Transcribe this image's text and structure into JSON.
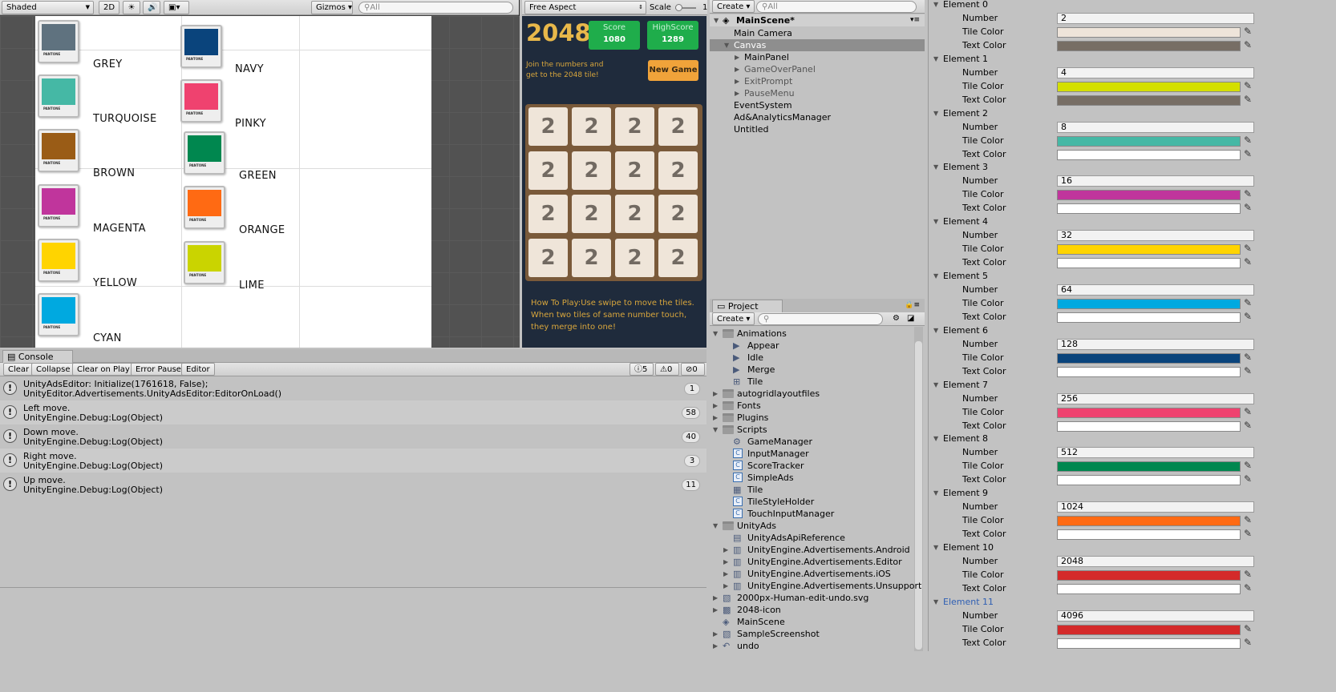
{
  "scene": {
    "shading": "Shaded",
    "mode_2d": "2D",
    "gizmos": "Gizmos",
    "search": "All",
    "colors": [
      {
        "name": "GREY",
        "hex": "#5f727f",
        "pl": "PANTONE"
      },
      {
        "name": "TURQUOISE",
        "hex": "#45b8a5",
        "pl": "PANTONE"
      },
      {
        "name": "BROWN",
        "hex": "#9a5c16",
        "pl": "PANTONE"
      },
      {
        "name": "MAGENTA",
        "hex": "#c0359c",
        "pl": "PANTONE"
      },
      {
        "name": "YELLOW",
        "hex": "#ffd400",
        "pl": "PANTONE"
      },
      {
        "name": "CYAN",
        "hex": "#00a9e0",
        "pl": "PANTONE"
      },
      {
        "name": "NAVY",
        "hex": "#0a447c",
        "pl": "PANTONE"
      },
      {
        "name": "PINKY",
        "hex": "#ef426f",
        "pl": "PANTONE"
      },
      {
        "name": "GREEN",
        "hex": "#00874f",
        "pl": "PANTONE"
      },
      {
        "name": "ORANGE",
        "hex": "#ff6a13",
        "pl": "PANTONE"
      },
      {
        "name": "LIME",
        "hex": "#cad400",
        "pl": "PANTONE"
      }
    ]
  },
  "game": {
    "aspect": "Free Aspect",
    "scale": "Scale",
    "scale_val": "1",
    "title": "2048",
    "score_label": "Score",
    "score": "1080",
    "high_label": "HighScore",
    "high": "1289",
    "tagline": "Join the numbers and get to the 2048 tile!",
    "new_game": "New Game",
    "tile_value": "2",
    "howto": "How To Play:Use swipe to move the tiles. When two tiles of same number touch, they merge into one!"
  },
  "console": {
    "tab": "Console",
    "buttons": [
      "Clear",
      "Collapse",
      "Clear on Play",
      "Error Pause",
      "Editor"
    ],
    "counts": [
      "5",
      "0",
      "0"
    ],
    "rows": [
      {
        "l1": "UnityAdsEditor: Initialize(1761618, False);",
        "l2": "UnityEditor.Advertisements.UnityAdsEditor:EditorOnLoad()",
        "n": "1"
      },
      {
        "l1": "Left move.",
        "l2": "UnityEngine.Debug:Log(Object)",
        "n": "58"
      },
      {
        "l1": "Down move.",
        "l2": "UnityEngine.Debug:Log(Object)",
        "n": "40"
      },
      {
        "l1": "Right move.",
        "l2": "UnityEngine.Debug:Log(Object)",
        "n": "3"
      },
      {
        "l1": "Up move.",
        "l2": "UnityEngine.Debug:Log(Object)",
        "n": "11"
      }
    ]
  },
  "hierarchy": {
    "create": "Create",
    "search": "All",
    "scene": "MainScene*",
    "items": [
      {
        "label": "Main Camera",
        "indent": 1,
        "arrow": "",
        "sel": false,
        "dim": false
      },
      {
        "label": "Canvas",
        "indent": 1,
        "arrow": "▼",
        "sel": true,
        "dim": false
      },
      {
        "label": "MainPanel",
        "indent": 2,
        "arrow": "▶",
        "sel": false,
        "dim": false
      },
      {
        "label": "GameOverPanel",
        "indent": 2,
        "arrow": "▶",
        "sel": false,
        "dim": true
      },
      {
        "label": "ExitPrompt",
        "indent": 2,
        "arrow": "▶",
        "sel": false,
        "dim": true
      },
      {
        "label": "PauseMenu",
        "indent": 2,
        "arrow": "▶",
        "sel": false,
        "dim": true
      },
      {
        "label": "EventSystem",
        "indent": 1,
        "arrow": "",
        "sel": false,
        "dim": false
      },
      {
        "label": "Ad&AnalyticsManager",
        "indent": 1,
        "arrow": "",
        "sel": false,
        "dim": false
      },
      {
        "label": "Untitled",
        "indent": 1,
        "arrow": "",
        "sel": false,
        "dim": false
      }
    ]
  },
  "project": {
    "tab": "Project",
    "create": "Create",
    "items": [
      {
        "label": "Animations",
        "lvl": 0,
        "arrow": "▼",
        "icon": "folder"
      },
      {
        "label": "Appear",
        "lvl": 1,
        "arrow": "",
        "icon": "anim"
      },
      {
        "label": "Idle",
        "lvl": 1,
        "arrow": "",
        "icon": "anim"
      },
      {
        "label": "Merge",
        "lvl": 1,
        "arrow": "",
        "icon": "anim"
      },
      {
        "label": "Tile",
        "lvl": 1,
        "arrow": "",
        "icon": "controller"
      },
      {
        "label": "autogridlayoutfiles",
        "lvl": 0,
        "arrow": "▶",
        "icon": "folder"
      },
      {
        "label": "Fonts",
        "lvl": 0,
        "arrow": "▶",
        "icon": "folder"
      },
      {
        "label": "Plugins",
        "lvl": 0,
        "arrow": "▶",
        "icon": "folder"
      },
      {
        "label": "Scripts",
        "lvl": 0,
        "arrow": "▼",
        "icon": "folder"
      },
      {
        "label": "GameManager",
        "lvl": 1,
        "arrow": "",
        "icon": "gear"
      },
      {
        "label": "InputManager",
        "lvl": 1,
        "arrow": "",
        "icon": "cs"
      },
      {
        "label": "ScoreTracker",
        "lvl": 1,
        "arrow": "",
        "icon": "cs"
      },
      {
        "label": "SimpleAds",
        "lvl": 1,
        "arrow": "",
        "icon": "cs"
      },
      {
        "label": "Tile",
        "lvl": 1,
        "arrow": "",
        "icon": "prefab"
      },
      {
        "label": "TileStyleHolder",
        "lvl": 1,
        "arrow": "",
        "icon": "cs"
      },
      {
        "label": "TouchInputManager",
        "lvl": 1,
        "arrow": "",
        "icon": "cs"
      },
      {
        "label": "UnityAds",
        "lvl": 0,
        "arrow": "▼",
        "icon": "folder"
      },
      {
        "label": "UnityAdsApiReference",
        "lvl": 1,
        "arrow": "",
        "icon": "pdf"
      },
      {
        "label": "UnityEngine.Advertisements.Android",
        "lvl": 1,
        "arrow": "▶",
        "icon": "dll"
      },
      {
        "label": "UnityEngine.Advertisements.Editor",
        "lvl": 1,
        "arrow": "▶",
        "icon": "dll"
      },
      {
        "label": "UnityEngine.Advertisements.iOS",
        "lvl": 1,
        "arrow": "▶",
        "icon": "dll"
      },
      {
        "label": "UnityEngine.Advertisements.Unsupport",
        "lvl": 1,
        "arrow": "▶",
        "icon": "dll"
      },
      {
        "label": "2000px-Human-edit-undo.svg",
        "lvl": 0,
        "arrow": "▶",
        "icon": "img"
      },
      {
        "label": "2048-icon",
        "lvl": 0,
        "arrow": "▶",
        "icon": "img2048"
      },
      {
        "label": "MainScene",
        "lvl": 0,
        "arrow": "",
        "icon": "unity"
      },
      {
        "label": "SampleScreenshot",
        "lvl": 0,
        "arrow": "▶",
        "icon": "img"
      },
      {
        "label": "undo",
        "lvl": 0,
        "arrow": "▶",
        "icon": "undo"
      }
    ]
  },
  "inspector": {
    "number_label": "Number",
    "tile_label": "Tile Color",
    "text_label": "Text Color",
    "elements": [
      {
        "name": "Element 0",
        "number": "2",
        "tile": "#eee4da",
        "text": "#776e65"
      },
      {
        "name": "Element 1",
        "number": "4",
        "tile": "#d4df00",
        "text": "#776e65"
      },
      {
        "name": "Element 2",
        "number": "8",
        "tile": "#45b8a5",
        "text": "#ffffff"
      },
      {
        "name": "Element 3",
        "number": "16",
        "tile": "#c0359c",
        "text": "#ffffff"
      },
      {
        "name": "Element 4",
        "number": "32",
        "tile": "#ffd400",
        "text": "#ffffff"
      },
      {
        "name": "Element 5",
        "number": "64",
        "tile": "#00a9e0",
        "text": "#ffffff"
      },
      {
        "name": "Element 6",
        "number": "128",
        "tile": "#0a447c",
        "text": "#ffffff"
      },
      {
        "name": "Element 7",
        "number": "256",
        "tile": "#ef426f",
        "text": "#ffffff"
      },
      {
        "name": "Element 8",
        "number": "512",
        "tile": "#00874f",
        "text": "#ffffff"
      },
      {
        "name": "Element 9",
        "number": "1024",
        "tile": "#ff6a13",
        "text": "#ffffff"
      },
      {
        "name": "Element 10",
        "number": "2048",
        "tile": "#d42a2a",
        "text": "#ffffff"
      },
      {
        "name": "Element 11",
        "number": "4096",
        "tile": "#d42a2a",
        "text": "#ffffff"
      }
    ]
  }
}
